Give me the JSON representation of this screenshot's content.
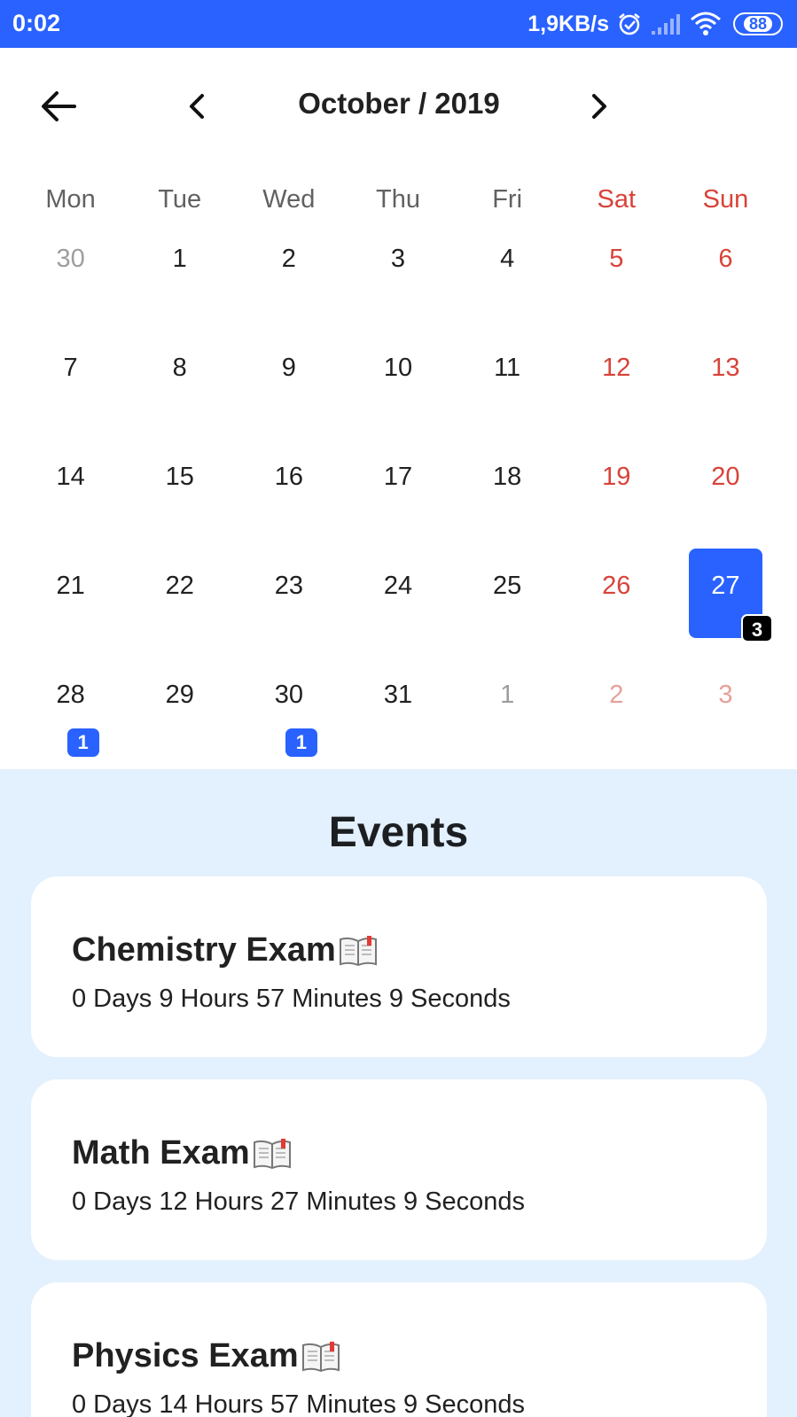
{
  "status_bar": {
    "time": "0:02",
    "net_speed": "1,9KB/s",
    "battery": "88"
  },
  "header": {
    "month_title": "October / 2019"
  },
  "calendar": {
    "weekdays": [
      "Mon",
      "Tue",
      "Wed",
      "Thu",
      "Fri",
      "Sat",
      "Sun"
    ],
    "days": [
      {
        "n": "30",
        "other": true
      },
      {
        "n": "1"
      },
      {
        "n": "2"
      },
      {
        "n": "3"
      },
      {
        "n": "4"
      },
      {
        "n": "5"
      },
      {
        "n": "6"
      },
      {
        "n": "7"
      },
      {
        "n": "8"
      },
      {
        "n": "9"
      },
      {
        "n": "10"
      },
      {
        "n": "11"
      },
      {
        "n": "12"
      },
      {
        "n": "13"
      },
      {
        "n": "14"
      },
      {
        "n": "15"
      },
      {
        "n": "16"
      },
      {
        "n": "17"
      },
      {
        "n": "18"
      },
      {
        "n": "19"
      },
      {
        "n": "20"
      },
      {
        "n": "21"
      },
      {
        "n": "22"
      },
      {
        "n": "23"
      },
      {
        "n": "24"
      },
      {
        "n": "25"
      },
      {
        "n": "26"
      },
      {
        "n": "27",
        "selected": true,
        "badge": "3"
      },
      {
        "n": "28",
        "badge": "1"
      },
      {
        "n": "29"
      },
      {
        "n": "30",
        "badge": "1"
      },
      {
        "n": "31"
      },
      {
        "n": "1",
        "other": true
      },
      {
        "n": "2",
        "other": true
      },
      {
        "n": "3",
        "other": true
      }
    ],
    "colors": {
      "accent": "#2962ff",
      "weekend": "#d84339"
    }
  },
  "events": {
    "title": "Events",
    "items": [
      {
        "name": "Chemistry Exam",
        "countdown": "0 Days 9 Hours 57 Minutes 9 Seconds",
        "icon": "open-book-icon"
      },
      {
        "name": "Math Exam",
        "countdown": "0 Days 12 Hours 27 Minutes 9 Seconds",
        "icon": "open-book-icon"
      },
      {
        "name": "Physics Exam",
        "countdown": "0 Days 14 Hours 57 Minutes 9 Seconds",
        "icon": "open-book-icon"
      }
    ]
  }
}
